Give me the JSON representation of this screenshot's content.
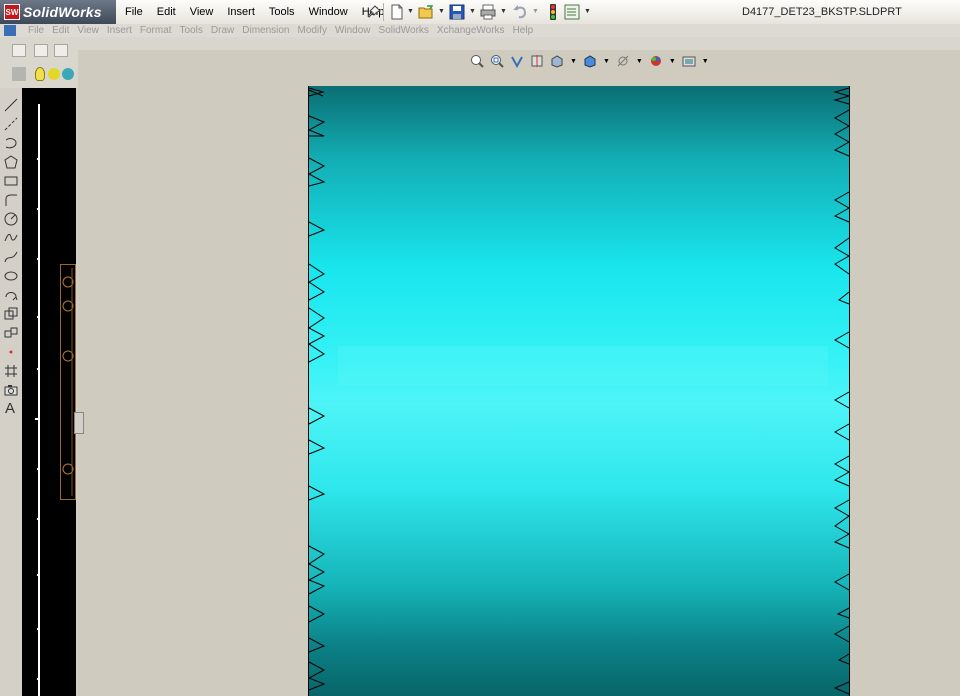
{
  "app": {
    "name": "SolidWorks",
    "logo_text": "SW",
    "document_title": "D4177_DET23_BKSTP.SLDPRT"
  },
  "menu": [
    "File",
    "Edit",
    "View",
    "Insert",
    "Tools",
    "Window",
    "Help"
  ],
  "ghost_menu": [
    "File",
    "Edit",
    "View",
    "Insert",
    "Format",
    "Tools",
    "Draw",
    "Dimension",
    "Modify",
    "Window",
    "SolidWorks",
    "XchangeWorks",
    "Help"
  ],
  "left_toolbar": {
    "text_tool_label": "A",
    "icons": [
      "line-icon",
      "centerline-icon",
      "arc-icon",
      "polygon-icon",
      "rectangle-icon",
      "fillet-icon",
      "circle-icon",
      "spline-icon",
      "ellipse-icon",
      "point-icon",
      "offset-icon",
      "mirror-icon",
      "trim-icon",
      "dimension-icon",
      "crop-icon",
      "camera-icon"
    ]
  },
  "colors": {
    "part_face": "#19e6ee",
    "brand_bar": "#4b5566",
    "graphics_bg": "#cfccbf"
  }
}
